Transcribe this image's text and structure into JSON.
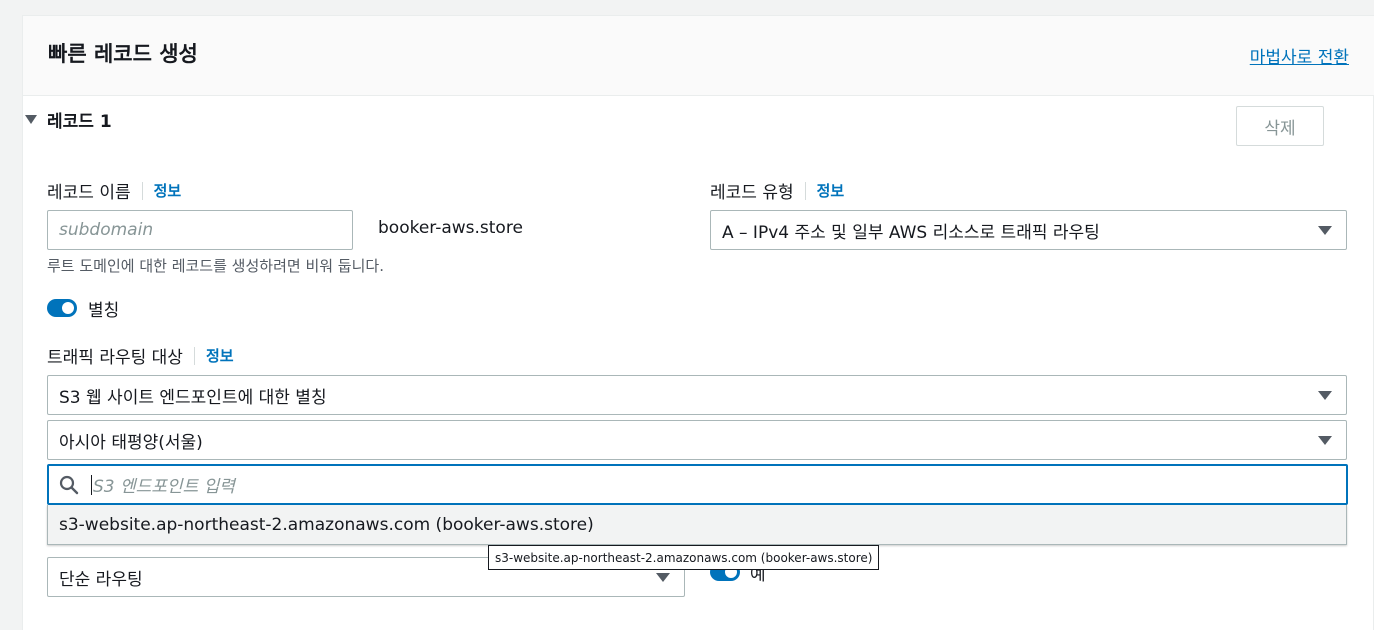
{
  "header": {
    "title": "빠른 레코드 생성",
    "wizard_link": "마법사로 전환"
  },
  "record": {
    "title": "레코드 1",
    "delete_label": "삭제",
    "name_label": "레코드 이름",
    "name_info": "정보",
    "name_placeholder": "subdomain",
    "domain_suffix": "booker-aws.store",
    "name_hint": "루트 도메인에 대한 레코드를 생성하려면 비워 둡니다.",
    "type_label": "레코드 유형",
    "type_info": "정보",
    "type_value": "A – IPv4 주소 및 일부 AWS 리소스로 트래픽 라우팅",
    "alias_label": "별칭",
    "alias_on": true,
    "target_label": "트래픽 라우팅 대상",
    "target_info": "정보",
    "target_type_value": "S3 웹 사이트 엔드포인트에 대한 별칭",
    "region_value": "아시아 태평양(서울)",
    "endpoint_placeholder": "S3 엔드포인트 입력",
    "endpoint_option": "s3-website.ap-northeast-2.amazonaws.com (booker-aws.store)",
    "tooltip": "s3-website.ap-northeast-2.amazonaws.com (booker-aws.store)",
    "routing_policy_value": "단순 라우팅",
    "evaluate_health_on": true,
    "evaluate_health_label": "예"
  }
}
